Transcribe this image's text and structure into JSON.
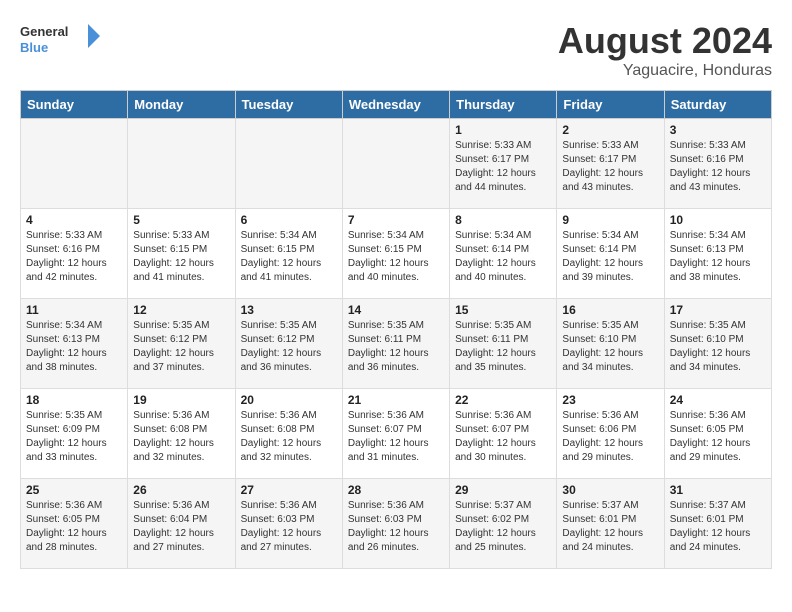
{
  "header": {
    "logo_general": "General",
    "logo_blue": "Blue",
    "main_title": "August 2024",
    "subtitle": "Yaguacire, Honduras"
  },
  "columns": [
    "Sunday",
    "Monday",
    "Tuesday",
    "Wednesday",
    "Thursday",
    "Friday",
    "Saturday"
  ],
  "weeks": [
    {
      "days": [
        {
          "number": "",
          "info": ""
        },
        {
          "number": "",
          "info": ""
        },
        {
          "number": "",
          "info": ""
        },
        {
          "number": "",
          "info": ""
        },
        {
          "number": "1",
          "info": "Sunrise: 5:33 AM\nSunset: 6:17 PM\nDaylight: 12 hours\nand 44 minutes."
        },
        {
          "number": "2",
          "info": "Sunrise: 5:33 AM\nSunset: 6:17 PM\nDaylight: 12 hours\nand 43 minutes."
        },
        {
          "number": "3",
          "info": "Sunrise: 5:33 AM\nSunset: 6:16 PM\nDaylight: 12 hours\nand 43 minutes."
        }
      ]
    },
    {
      "days": [
        {
          "number": "4",
          "info": "Sunrise: 5:33 AM\nSunset: 6:16 PM\nDaylight: 12 hours\nand 42 minutes."
        },
        {
          "number": "5",
          "info": "Sunrise: 5:33 AM\nSunset: 6:15 PM\nDaylight: 12 hours\nand 41 minutes."
        },
        {
          "number": "6",
          "info": "Sunrise: 5:34 AM\nSunset: 6:15 PM\nDaylight: 12 hours\nand 41 minutes."
        },
        {
          "number": "7",
          "info": "Sunrise: 5:34 AM\nSunset: 6:15 PM\nDaylight: 12 hours\nand 40 minutes."
        },
        {
          "number": "8",
          "info": "Sunrise: 5:34 AM\nSunset: 6:14 PM\nDaylight: 12 hours\nand 40 minutes."
        },
        {
          "number": "9",
          "info": "Sunrise: 5:34 AM\nSunset: 6:14 PM\nDaylight: 12 hours\nand 39 minutes."
        },
        {
          "number": "10",
          "info": "Sunrise: 5:34 AM\nSunset: 6:13 PM\nDaylight: 12 hours\nand 38 minutes."
        }
      ]
    },
    {
      "days": [
        {
          "number": "11",
          "info": "Sunrise: 5:34 AM\nSunset: 6:13 PM\nDaylight: 12 hours\nand 38 minutes."
        },
        {
          "number": "12",
          "info": "Sunrise: 5:35 AM\nSunset: 6:12 PM\nDaylight: 12 hours\nand 37 minutes."
        },
        {
          "number": "13",
          "info": "Sunrise: 5:35 AM\nSunset: 6:12 PM\nDaylight: 12 hours\nand 36 minutes."
        },
        {
          "number": "14",
          "info": "Sunrise: 5:35 AM\nSunset: 6:11 PM\nDaylight: 12 hours\nand 36 minutes."
        },
        {
          "number": "15",
          "info": "Sunrise: 5:35 AM\nSunset: 6:11 PM\nDaylight: 12 hours\nand 35 minutes."
        },
        {
          "number": "16",
          "info": "Sunrise: 5:35 AM\nSunset: 6:10 PM\nDaylight: 12 hours\nand 34 minutes."
        },
        {
          "number": "17",
          "info": "Sunrise: 5:35 AM\nSunset: 6:10 PM\nDaylight: 12 hours\nand 34 minutes."
        }
      ]
    },
    {
      "days": [
        {
          "number": "18",
          "info": "Sunrise: 5:35 AM\nSunset: 6:09 PM\nDaylight: 12 hours\nand 33 minutes."
        },
        {
          "number": "19",
          "info": "Sunrise: 5:36 AM\nSunset: 6:08 PM\nDaylight: 12 hours\nand 32 minutes."
        },
        {
          "number": "20",
          "info": "Sunrise: 5:36 AM\nSunset: 6:08 PM\nDaylight: 12 hours\nand 32 minutes."
        },
        {
          "number": "21",
          "info": "Sunrise: 5:36 AM\nSunset: 6:07 PM\nDaylight: 12 hours\nand 31 minutes."
        },
        {
          "number": "22",
          "info": "Sunrise: 5:36 AM\nSunset: 6:07 PM\nDaylight: 12 hours\nand 30 minutes."
        },
        {
          "number": "23",
          "info": "Sunrise: 5:36 AM\nSunset: 6:06 PM\nDaylight: 12 hours\nand 29 minutes."
        },
        {
          "number": "24",
          "info": "Sunrise: 5:36 AM\nSunset: 6:05 PM\nDaylight: 12 hours\nand 29 minutes."
        }
      ]
    },
    {
      "days": [
        {
          "number": "25",
          "info": "Sunrise: 5:36 AM\nSunset: 6:05 PM\nDaylight: 12 hours\nand 28 minutes."
        },
        {
          "number": "26",
          "info": "Sunrise: 5:36 AM\nSunset: 6:04 PM\nDaylight: 12 hours\nand 27 minutes."
        },
        {
          "number": "27",
          "info": "Sunrise: 5:36 AM\nSunset: 6:03 PM\nDaylight: 12 hours\nand 27 minutes."
        },
        {
          "number": "28",
          "info": "Sunrise: 5:36 AM\nSunset: 6:03 PM\nDaylight: 12 hours\nand 26 minutes."
        },
        {
          "number": "29",
          "info": "Sunrise: 5:37 AM\nSunset: 6:02 PM\nDaylight: 12 hours\nand 25 minutes."
        },
        {
          "number": "30",
          "info": "Sunrise: 5:37 AM\nSunset: 6:01 PM\nDaylight: 12 hours\nand 24 minutes."
        },
        {
          "number": "31",
          "info": "Sunrise: 5:37 AM\nSunset: 6:01 PM\nDaylight: 12 hours\nand 24 minutes."
        }
      ]
    }
  ]
}
